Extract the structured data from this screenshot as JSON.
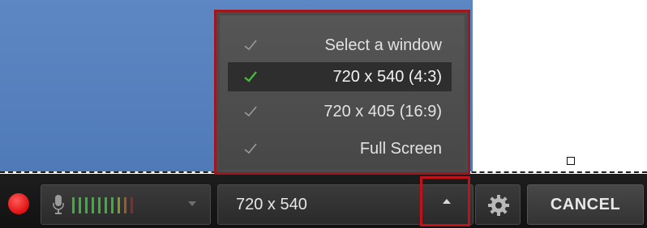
{
  "resolution_menu": {
    "items": [
      {
        "label": "Select a window",
        "checked": false
      },
      {
        "label": "720 x 540 (4:3)",
        "checked": true
      },
      {
        "label": "720 x 405 (16:9)",
        "checked": false
      },
      {
        "label": "Full Screen",
        "checked": false
      }
    ]
  },
  "toolbar": {
    "record_icon": "record-icon",
    "mic_icon": "microphone-icon",
    "audio_level_colors": [
      "#3bb03b",
      "#3bb03b",
      "#3bb03b",
      "#3bb03b",
      "#3bb03b",
      "#3bb03b",
      "#3bb03b",
      "#7a9a2a",
      "#9a5a2a",
      "#8a2a2a"
    ],
    "selected_size": "720 x 540",
    "dropdown_icon": "chevron-up-icon",
    "settings_icon": "gear-icon",
    "cancel_label": "CANCEL"
  },
  "colors": {
    "capture_area": "#5a84c0",
    "highlight_border": "#c1121a",
    "check_active": "#4ab83a",
    "check_inactive": "#9a9a9a"
  }
}
